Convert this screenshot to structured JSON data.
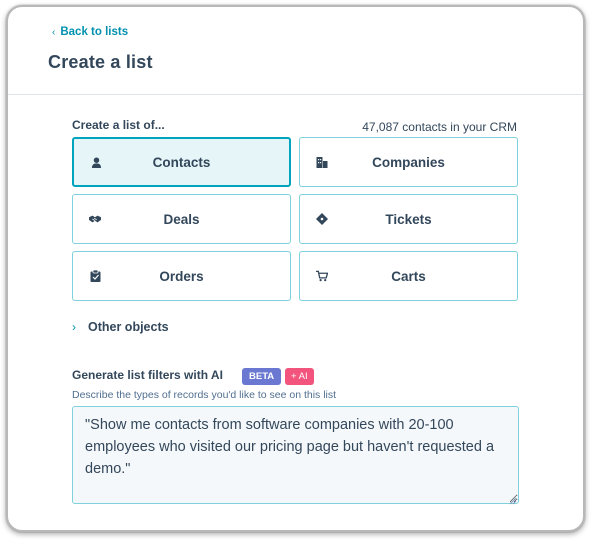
{
  "header": {
    "back_label": "Back to lists",
    "title": "Create a list"
  },
  "object_picker": {
    "label": "Create a list of...",
    "crm_count": "47,087 contacts in your CRM",
    "tiles": [
      {
        "label": "Contacts",
        "icon": "person-icon",
        "selected": true
      },
      {
        "label": "Companies",
        "icon": "building-icon",
        "selected": false
      },
      {
        "label": "Deals",
        "icon": "handshake-icon",
        "selected": false
      },
      {
        "label": "Tickets",
        "icon": "ticket-icon",
        "selected": false
      },
      {
        "label": "Orders",
        "icon": "clipboard-icon",
        "selected": false
      },
      {
        "label": "Carts",
        "icon": "cart-icon",
        "selected": false
      }
    ],
    "other_objects_label": "Other objects"
  },
  "ai_filters": {
    "title": "Generate list filters with AI",
    "beta_badge": "BETA",
    "ai_badge": "+ AI",
    "description": "Describe the types of records you'd like to see on this list",
    "prompt_value": "\"Show me contacts from software companies with 20-100 employees who visited our pricing page but haven't requested a demo.\""
  },
  "colors": {
    "accent": "#00a4bd",
    "link": "#0091ae",
    "text": "#33475b",
    "selected_bg": "#e5f5f8",
    "beta_badge": "#6a78d1",
    "ai_badge": "#f2547d"
  }
}
